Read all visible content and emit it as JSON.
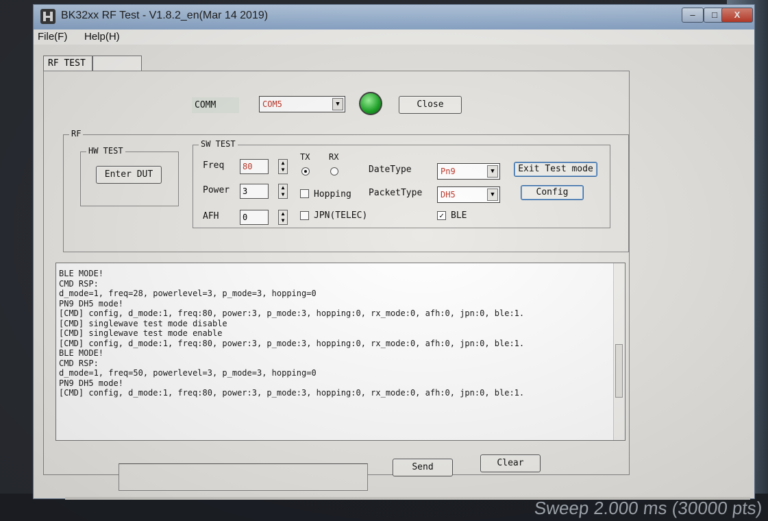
{
  "window": {
    "title": "BK32xx RF Test - V1.8.2_en(Mar 14 2019)",
    "controls": {
      "minimize": "–",
      "maximize": "□",
      "close": "X"
    }
  },
  "menu": [
    "File(F)",
    "Help(H)"
  ],
  "tabs": [
    "RF TEST",
    ""
  ],
  "comm": {
    "label": "COMM",
    "port": "COM5",
    "close_label": "Close"
  },
  "rf_group": {
    "label": "RF"
  },
  "hw_test": {
    "label": "HW TEST",
    "enter_dut": "Enter DUT"
  },
  "sw_test": {
    "label": "SW TEST",
    "freq_label": "Freq",
    "freq_value": "80",
    "power_label": "Power",
    "power_value": "3",
    "afh_label": "AFH",
    "afh_value": "0",
    "tx_label": "TX",
    "rx_label": "RX",
    "hopping_label": "Hopping",
    "jpn_label": "JPN(TELEC)",
    "datetype_label": "DateType",
    "datetype_value": "Pn9",
    "packettype_label": "PacketType",
    "packettype_value": "DH5",
    "ble_label": "BLE",
    "exit_test_mode": "Exit Test mode",
    "config": "Config",
    "checkmark": "✓"
  },
  "log_lines": [
    "BLE MODE!",
    "CMD RSP:",
    "d_mode=1, freq=28, powerlevel=3, p_mode=3, hopping=0",
    "PN9 DH5 mode!",
    "[CMD] config, d_mode:1, freq:80, power:3, p_mode:3, hopping:0, rx_mode:0, afh:0, jpn:0, ble:1.",
    "[CMD] singlewave test mode disable",
    "[CMD] singlewave test mode enable",
    "[CMD] config, d_mode:1, freq:80, power:3, p_mode:3, hopping:0, rx_mode:0, afh:0, jpn:0, ble:1.",
    "",
    "BLE MODE!",
    "CMD RSP:",
    "d_mode=1, freq=50, powerlevel=3, p_mode=3, hopping=0",
    "PN9 DH5 mode!",
    "[CMD] config, d_mode:1, freq:80, power:3, p_mode:3, hopping:0, rx_mode:0, afh:0, jpn:0, ble:1."
  ],
  "send_label": "Send",
  "clear_label": "Clear",
  "background_text": "Sweep 2.000 ms (30000 pts)"
}
